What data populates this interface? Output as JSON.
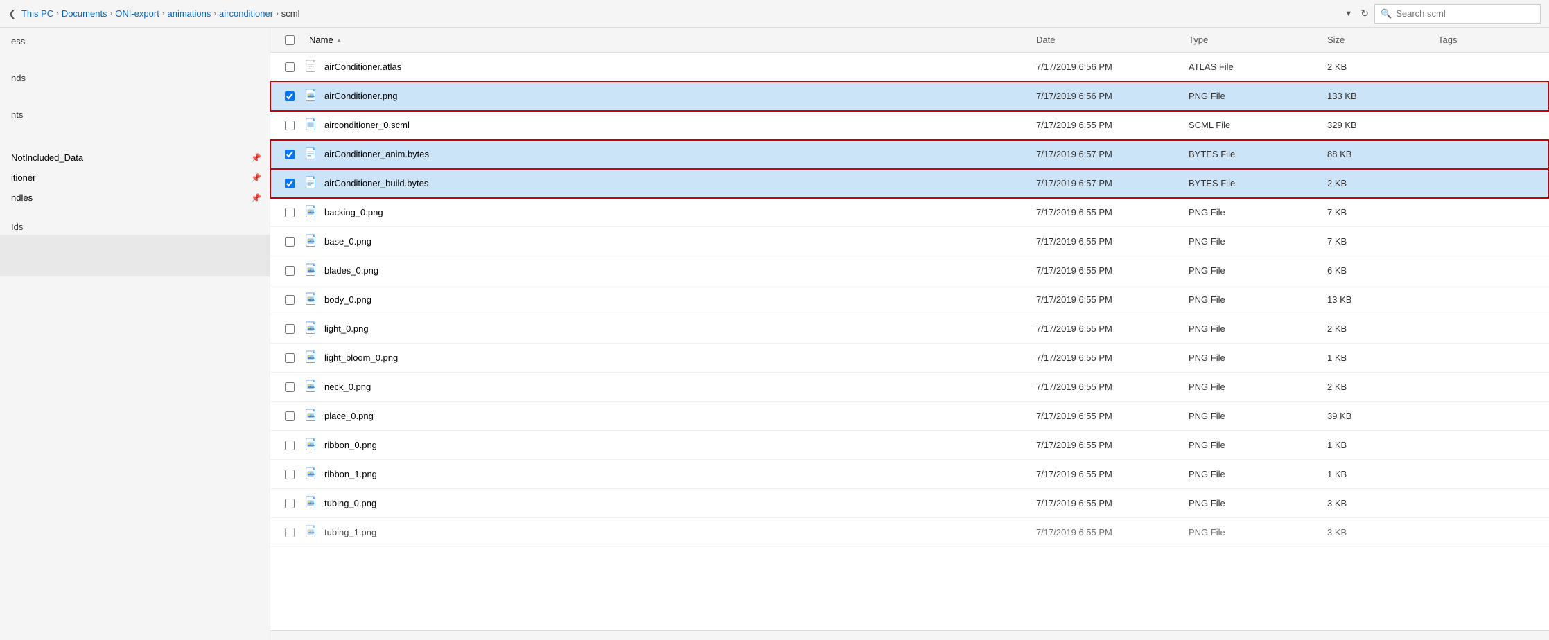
{
  "addressBar": {
    "breadcrumbs": [
      {
        "label": "This PC",
        "sep": "›"
      },
      {
        "label": "Documents",
        "sep": "›"
      },
      {
        "label": "ONI-export",
        "sep": "›"
      },
      {
        "label": "animations",
        "sep": "›"
      },
      {
        "label": "airconditioner",
        "sep": "›"
      },
      {
        "label": "scml",
        "sep": ""
      }
    ],
    "search_placeholder": "Search scml"
  },
  "sidebar": {
    "partial_labels": [
      "ess",
      "nds",
      "nts"
    ],
    "pinned_items": [
      {
        "label": "NotIncluded_Data"
      },
      {
        "label": "itioner"
      },
      {
        "label": "ndles"
      }
    ],
    "ids_label": "Ids"
  },
  "columns": {
    "headers": [
      {
        "key": "checkbox",
        "label": ""
      },
      {
        "key": "name",
        "label": "Name",
        "active": true,
        "has_arrow": true
      },
      {
        "key": "date",
        "label": "Date"
      },
      {
        "key": "type",
        "label": "Type"
      },
      {
        "key": "size",
        "label": "Size"
      },
      {
        "key": "tags",
        "label": "Tags"
      }
    ]
  },
  "files": [
    {
      "name": "airConditioner.atlas",
      "date": "7/17/2019 6:56 PM",
      "type": "ATLAS File",
      "size": "2 KB",
      "tags": "",
      "icon": "atlas",
      "selected": false,
      "highlighted": false,
      "checked": false
    },
    {
      "name": "airConditioner.png",
      "date": "7/17/2019 6:56 PM",
      "type": "PNG File",
      "size": "133 KB",
      "tags": "",
      "icon": "png",
      "selected": true,
      "highlighted": true,
      "checked": true
    },
    {
      "name": "airconditioner_0.scml",
      "date": "7/17/2019 6:55 PM",
      "type": "SCML File",
      "size": "329 KB",
      "tags": "",
      "icon": "scml",
      "selected": false,
      "highlighted": false,
      "checked": false
    },
    {
      "name": "airConditioner_anim.bytes",
      "date": "7/17/2019 6:57 PM",
      "type": "BYTES File",
      "size": "88 KB",
      "tags": "",
      "icon": "bytes",
      "selected": true,
      "highlighted": true,
      "checked": true
    },
    {
      "name": "airConditioner_build.bytes",
      "date": "7/17/2019 6:57 PM",
      "type": "BYTES File",
      "size": "2 KB",
      "tags": "",
      "icon": "bytes",
      "selected": true,
      "highlighted": true,
      "checked": true
    },
    {
      "name": "backing_0.png",
      "date": "7/17/2019 6:55 PM",
      "type": "PNG File",
      "size": "7 KB",
      "tags": "",
      "icon": "png",
      "selected": false,
      "highlighted": false,
      "checked": false
    },
    {
      "name": "base_0.png",
      "date": "7/17/2019 6:55 PM",
      "type": "PNG File",
      "size": "7 KB",
      "tags": "",
      "icon": "png",
      "selected": false,
      "highlighted": false,
      "checked": false
    },
    {
      "name": "blades_0.png",
      "date": "7/17/2019 6:55 PM",
      "type": "PNG File",
      "size": "6 KB",
      "tags": "",
      "icon": "png",
      "selected": false,
      "highlighted": false,
      "checked": false
    },
    {
      "name": "body_0.png",
      "date": "7/17/2019 6:55 PM",
      "type": "PNG File",
      "size": "13 KB",
      "tags": "",
      "icon": "png",
      "selected": false,
      "highlighted": false,
      "checked": false
    },
    {
      "name": "light_0.png",
      "date": "7/17/2019 6:55 PM",
      "type": "PNG File",
      "size": "2 KB",
      "tags": "",
      "icon": "png",
      "selected": false,
      "highlighted": false,
      "checked": false
    },
    {
      "name": "light_bloom_0.png",
      "date": "7/17/2019 6:55 PM",
      "type": "PNG File",
      "size": "1 KB",
      "tags": "",
      "icon": "png",
      "selected": false,
      "highlighted": false,
      "checked": false
    },
    {
      "name": "neck_0.png",
      "date": "7/17/2019 6:55 PM",
      "type": "PNG File",
      "size": "2 KB",
      "tags": "",
      "icon": "png",
      "selected": false,
      "highlighted": false,
      "checked": false
    },
    {
      "name": "place_0.png",
      "date": "7/17/2019 6:55 PM",
      "type": "PNG File",
      "size": "39 KB",
      "tags": "",
      "icon": "png",
      "selected": false,
      "highlighted": false,
      "checked": false
    },
    {
      "name": "ribbon_0.png",
      "date": "7/17/2019 6:55 PM",
      "type": "PNG File",
      "size": "1 KB",
      "tags": "",
      "icon": "png",
      "selected": false,
      "highlighted": false,
      "checked": false
    },
    {
      "name": "ribbon_1.png",
      "date": "7/17/2019 6:55 PM",
      "type": "PNG File",
      "size": "1 KB",
      "tags": "",
      "icon": "png",
      "selected": false,
      "highlighted": false,
      "checked": false
    },
    {
      "name": "tubing_0.png",
      "date": "7/17/2019 6:55 PM",
      "type": "PNG File",
      "size": "3 KB",
      "tags": "",
      "icon": "png",
      "selected": false,
      "highlighted": false,
      "checked": false
    },
    {
      "name": "tubing_1.png",
      "date": "7/17/2019 6:55 PM",
      "type": "PNG File",
      "size": "3 KB",
      "tags": "",
      "icon": "png",
      "selected": false,
      "highlighted": false,
      "checked": false,
      "partial": true
    }
  ]
}
